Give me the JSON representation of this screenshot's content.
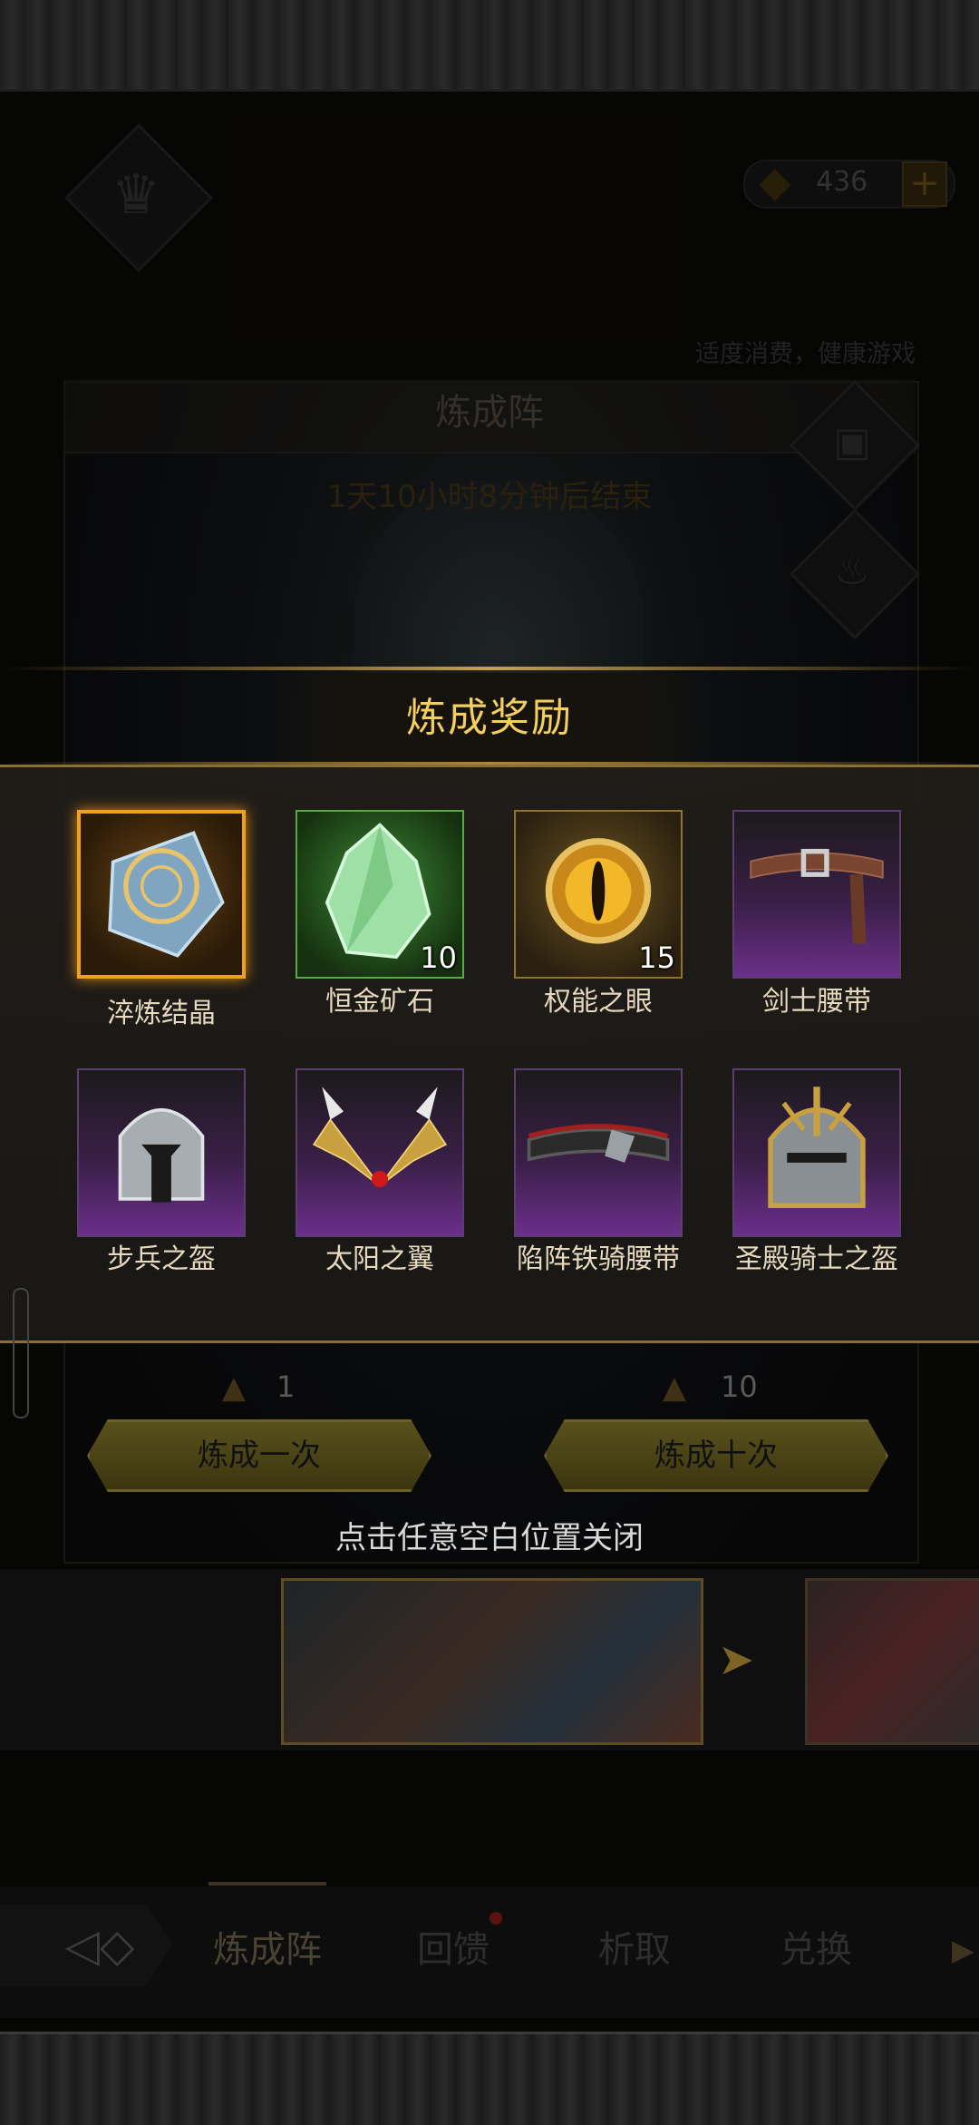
{
  "hud": {
    "currency_value": "436",
    "plus_symbol": "+",
    "notice": "适度消费，健康游戏"
  },
  "panel": {
    "title": "炼成阵",
    "timer": "1天10小时8分钟后结束"
  },
  "modal": {
    "title": "炼成奖励",
    "items": [
      {
        "name": "淬炼结晶",
        "qty": "",
        "rarity": "orange",
        "icon": "crystal-disc-icon"
      },
      {
        "name": "恒金矿石",
        "qty": "10",
        "rarity": "green",
        "icon": "ore-icon"
      },
      {
        "name": "权能之眼",
        "qty": "15",
        "rarity": "gold",
        "icon": "eye-icon"
      },
      {
        "name": "剑士腰带",
        "qty": "",
        "rarity": "purple",
        "icon": "belt-icon"
      },
      {
        "name": "步兵之盔",
        "qty": "",
        "rarity": "purple",
        "icon": "helmet-icon"
      },
      {
        "name": "太阳之翼",
        "qty": "",
        "rarity": "purple",
        "icon": "wings-icon"
      },
      {
        "name": "陷阵铁骑腰带",
        "qty": "",
        "rarity": "purple",
        "icon": "belt-icon"
      },
      {
        "name": "圣殿骑士之盔",
        "qty": "",
        "rarity": "purple",
        "icon": "helmet-icon"
      }
    ]
  },
  "craft": {
    "once_cost": "1",
    "ten_cost": "10",
    "once_label": "炼成一次",
    "ten_label": "炼成十次"
  },
  "close_hint": "点击任意空白位置关闭",
  "nav": {
    "items": [
      "炼成阵",
      "回馈",
      "析取",
      "兑换"
    ]
  }
}
